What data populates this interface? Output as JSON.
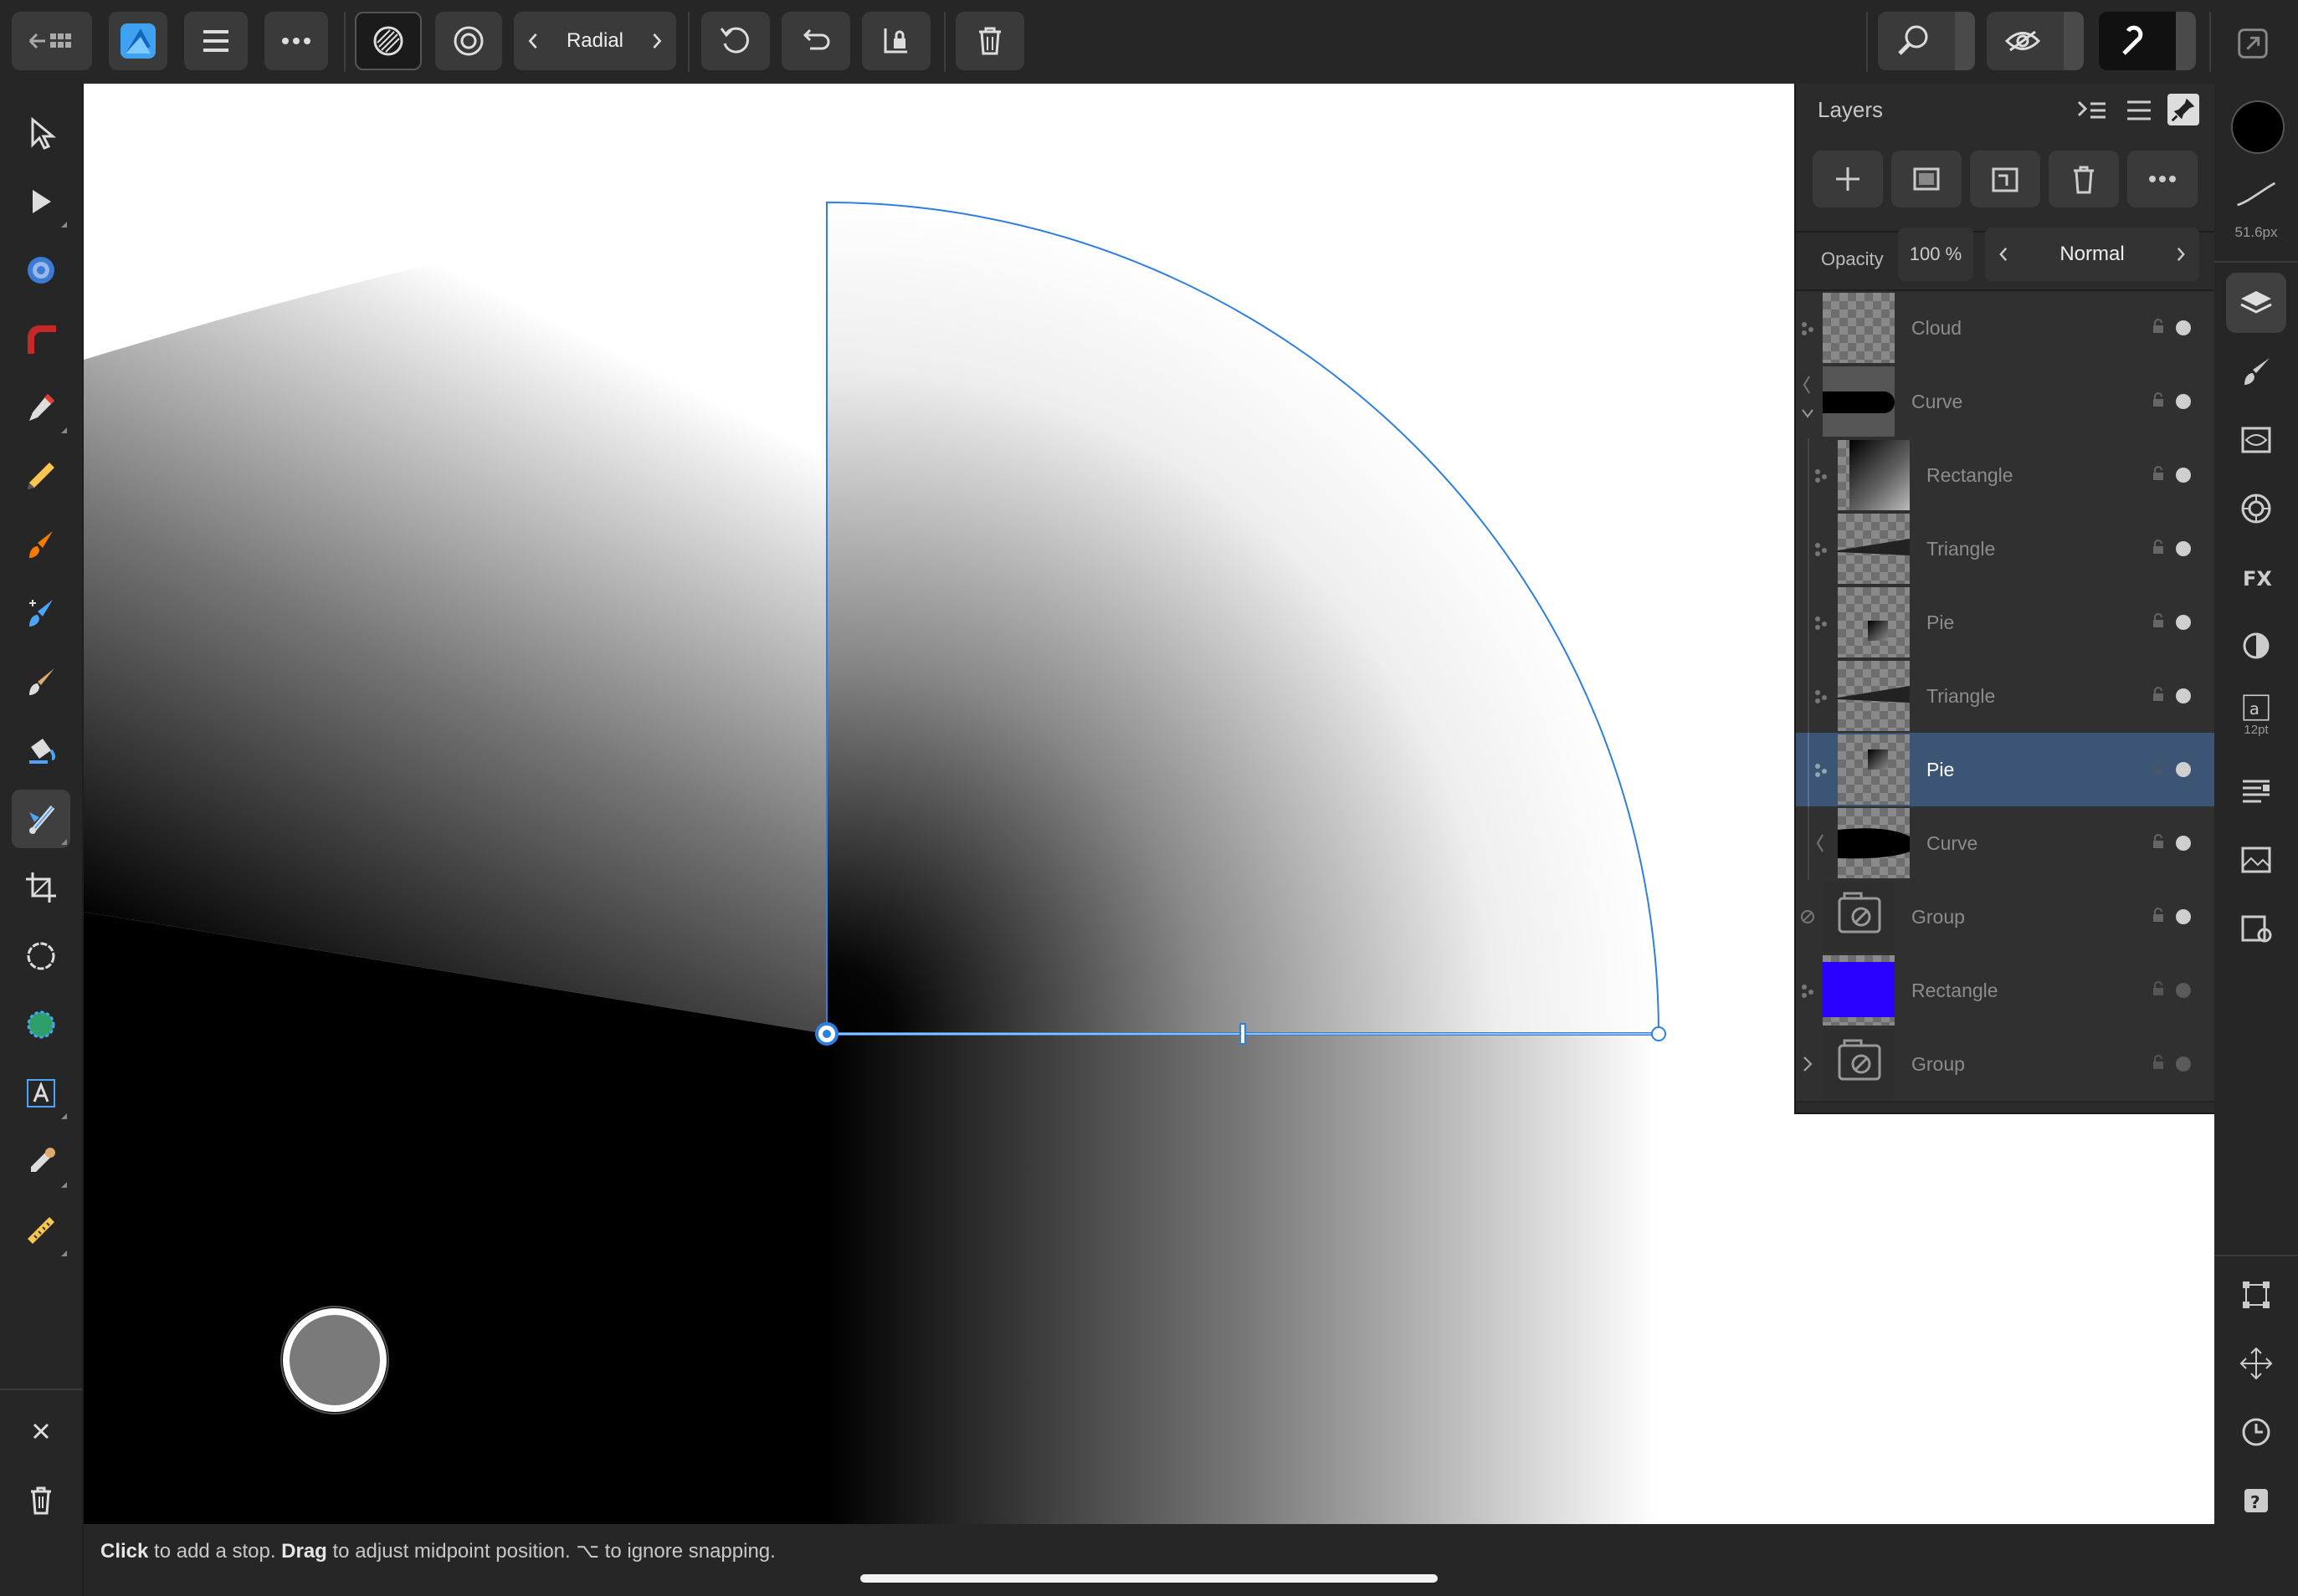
{
  "toolbar": {
    "gradient_type": "Radial",
    "icons": [
      "back-grid-icon",
      "affinity-photo-logo",
      "hamburger-menu-icon",
      "more-icon",
      "gradient-swatch-icon",
      "radial-icon",
      "prev-arrow-icon",
      "next-arrow-icon",
      "reverse-icon",
      "undo-reverse-icon",
      "lock-stop-icon",
      "delete-icon",
      "zoom-icon",
      "vision-icon",
      "snapping-icon",
      "expand-icon"
    ]
  },
  "layers_panel": {
    "title": "Layers",
    "opacity_label": "Opacity",
    "opacity_value": "100 %",
    "blend_mode": "Normal",
    "rows": [
      {
        "name": "Cloud",
        "selected": false,
        "visible": true
      },
      {
        "name": "Curve",
        "selected": false,
        "visible": true
      },
      {
        "name": "Rectangle",
        "selected": false,
        "visible": true
      },
      {
        "name": "Triangle",
        "selected": false,
        "visible": true
      },
      {
        "name": "Pie",
        "selected": false,
        "visible": true
      },
      {
        "name": "Triangle",
        "selected": false,
        "visible": true
      },
      {
        "name": "Pie",
        "selected": true,
        "visible": true
      },
      {
        "name": "Curve",
        "selected": false,
        "visible": true
      },
      {
        "name": "Group",
        "selected": false,
        "visible": true
      },
      {
        "name": "Rectangle",
        "selected": false,
        "visible": false
      },
      {
        "name": "Group",
        "selected": false,
        "visible": false
      }
    ]
  },
  "right_strip": {
    "brush_size": "51.6px",
    "font_size": "12pt",
    "primary_color": "#000000"
  },
  "status": {
    "hint_click": "Click",
    "hint_part1": " to add a stop. ",
    "hint_drag": "Drag",
    "hint_part2": " to adjust midpoint position. ⌥ to ignore snapping."
  },
  "colors": {
    "accent_blue": "#2f7fe0",
    "selected_row": "#3c5575",
    "rectangle_thumb": "#2a00ff"
  }
}
